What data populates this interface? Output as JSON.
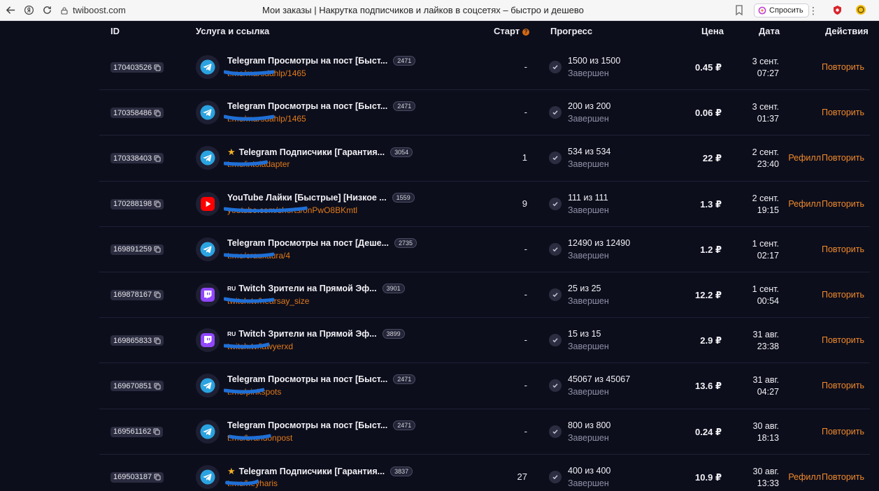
{
  "browser": {
    "url": "twiboost.com",
    "page_title": "Мои заказы | Накрутка подписчиков и лайков в соцсетях – быстро и дешево",
    "ask_label": "Спросить"
  },
  "table": {
    "headers": {
      "id": "ID",
      "service": "Услуга и ссылка",
      "start": "Старт",
      "progress": "Прогресс",
      "price": "Цена",
      "date": "Дата",
      "actions": "Действия"
    },
    "start_help": "?",
    "rows": [
      {
        "id": "170403526",
        "icon": "telegram-icon",
        "prefix": "",
        "star": "",
        "name": "Telegram Просмотры на пост [Быст...",
        "badge": "2471",
        "link": "t.me/marsdahlp/1465",
        "start": "-",
        "amount": "1500 из 1500",
        "status": "Завершен",
        "price": "0.45 ₽",
        "date": "3 сент.",
        "time": "07:27",
        "refill": "",
        "repeat": "Повторить"
      },
      {
        "id": "170358486",
        "icon": "telegram-icon",
        "prefix": "",
        "star": "",
        "name": "Telegram Просмотры на пост [Быст...",
        "badge": "2471",
        "link": "t.me/marsdahlp/1465",
        "start": "-",
        "amount": "200 из 200",
        "status": "Завершен",
        "price": "0.06 ₽",
        "date": "3 сент.",
        "time": "01:37",
        "refill": "",
        "repeat": "Повторить"
      },
      {
        "id": "170338403",
        "icon": "telegram-icon",
        "prefix": "",
        "star": "★",
        "name": "Telegram Подписчики [Гарантия...",
        "badge": "3054",
        "link": "t.me/intoladapter",
        "start": "1",
        "amount": "534 из 534",
        "status": "Завершен",
        "price": "22 ₽",
        "date": "2 сент.",
        "time": "23:40",
        "refill": "Рефилл",
        "repeat": "Повторить"
      },
      {
        "id": "170288198",
        "icon": "youtube-icon",
        "prefix": "",
        "star": "",
        "name": "YouTube Лайки [Быстрые] [Низкое ...",
        "badge": "1559",
        "link": "youtube.com/shorts/onPwO8BKmtl",
        "start": "9",
        "amount": "111 из 111",
        "status": "Завершен",
        "price": "1.3 ₽",
        "date": "2 сент.",
        "time": "19:15",
        "refill": "Рефилл",
        "repeat": "Повторить"
      },
      {
        "id": "169891259",
        "icon": "telegram-icon",
        "prefix": "",
        "star": "",
        "name": "Telegram Просмотры на пост [Деше...",
        "badge": "2735",
        "link": "t.me/crauxaura/4",
        "start": "-",
        "amount": "12490 из 12490",
        "status": "Завершен",
        "price": "1.2 ₽",
        "date": "1 сент.",
        "time": "02:17",
        "refill": "",
        "repeat": "Повторить"
      },
      {
        "id": "169878167",
        "icon": "twitch-icon",
        "prefix": "RU",
        "star": "",
        "name": "Twitch Зрители на Прямой Эф...",
        "badge": "3901",
        "link": "twitch.tv/hearsay_size",
        "start": "-",
        "amount": "25 из 25",
        "status": "Завершен",
        "price": "12.2 ₽",
        "date": "1 сент.",
        "time": "00:54",
        "refill": "",
        "repeat": "Повторить"
      },
      {
        "id": "169865833",
        "icon": "twitch-icon",
        "prefix": "RU",
        "star": "",
        "name": "Twitch Зрители на Прямой Эф...",
        "badge": "3899",
        "link": "twitch.tv/lawyerxd",
        "start": "-",
        "amount": "15 из 15",
        "status": "Завершен",
        "price": "2.9 ₽",
        "date": "31 авг.",
        "time": "23:38",
        "refill": "",
        "repeat": "Повторить"
      },
      {
        "id": "169670851",
        "icon": "telegram-icon",
        "prefix": "",
        "star": "",
        "name": "Telegram Просмотры на пост [Быст...",
        "badge": "2471",
        "link": "t.me/pinkspots",
        "start": "-",
        "amount": "45067 из 45067",
        "status": "Завершен",
        "price": "13.6 ₽",
        "date": "31 авг.",
        "time": "04:27",
        "refill": "",
        "repeat": "Повторить"
      },
      {
        "id": "169561162",
        "icon": "telegram-icon",
        "prefix": "",
        "star": "",
        "name": "Telegram Просмотры на пост [Быст...",
        "badge": "2471",
        "link": "t.me/brandonpost",
        "start": "-",
        "amount": "800 из 800",
        "status": "Завершен",
        "price": "0.24 ₽",
        "date": "30 авг.",
        "time": "18:13",
        "refill": "",
        "repeat": "Повторить"
      },
      {
        "id": "169503187",
        "icon": "telegram-icon",
        "prefix": "",
        "star": "★",
        "name": "Telegram Подписчики [Гарантия...",
        "badge": "3837",
        "link": "t.me/heyharis",
        "start": "27",
        "amount": "400 из 400",
        "status": "Завершен",
        "price": "10.9 ₽",
        "date": "30 авг.",
        "time": "13:33",
        "refill": "Рефилл",
        "repeat": "Повторить"
      }
    ]
  },
  "colors": {
    "background": "#0d0e1c",
    "accent": "#f08a2a",
    "telegram": "#2aa3e0",
    "youtube": "#ff0000",
    "twitch": "#9146ff",
    "scribble": "#1f6fd6"
  }
}
